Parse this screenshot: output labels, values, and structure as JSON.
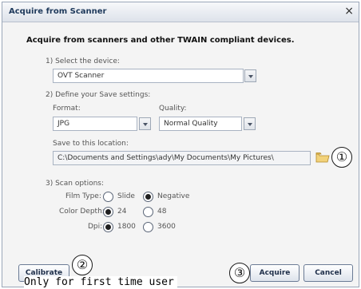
{
  "window": {
    "title": "Acquire from Scanner",
    "close_glyph": "×"
  },
  "heading": "Acquire from scanners and other TWAIN compliant devices.",
  "device": {
    "label": "1) Select the device:",
    "value": "OVT Scanner"
  },
  "save_settings": {
    "label": "2) Define your Save settings:",
    "format_label": "Format:",
    "format_value": "JPG",
    "quality_label": "Quality:",
    "quality_value": "Normal Quality",
    "location_label": "Save to this location:",
    "location_value": "C:\\Documents and Settings\\ady\\My Documents\\My Pictures\\",
    "browse_icon": "folder-icon"
  },
  "scan_options": {
    "label": "3) Scan options:",
    "film_type": {
      "label": "Film Type:",
      "options": [
        "Slide",
        "Negative"
      ],
      "selected": "Negative"
    },
    "color_depth": {
      "label": "Color Depth:",
      "options": [
        "24",
        "48"
      ],
      "selected": "24"
    },
    "dpi": {
      "label": "Dpi:",
      "options": [
        "1800",
        "3600"
      ],
      "selected": "1800"
    }
  },
  "buttons": {
    "calibrate": "Calibrate",
    "acquire": "Acquire",
    "cancel": "Cancel"
  },
  "callouts": [
    "①",
    "②",
    "③"
  ],
  "note": "Only for first time user",
  "colors": {
    "title_text": "#1e395b",
    "dialog_bg": "#f4f4f4",
    "folder": "#e8c35a"
  }
}
